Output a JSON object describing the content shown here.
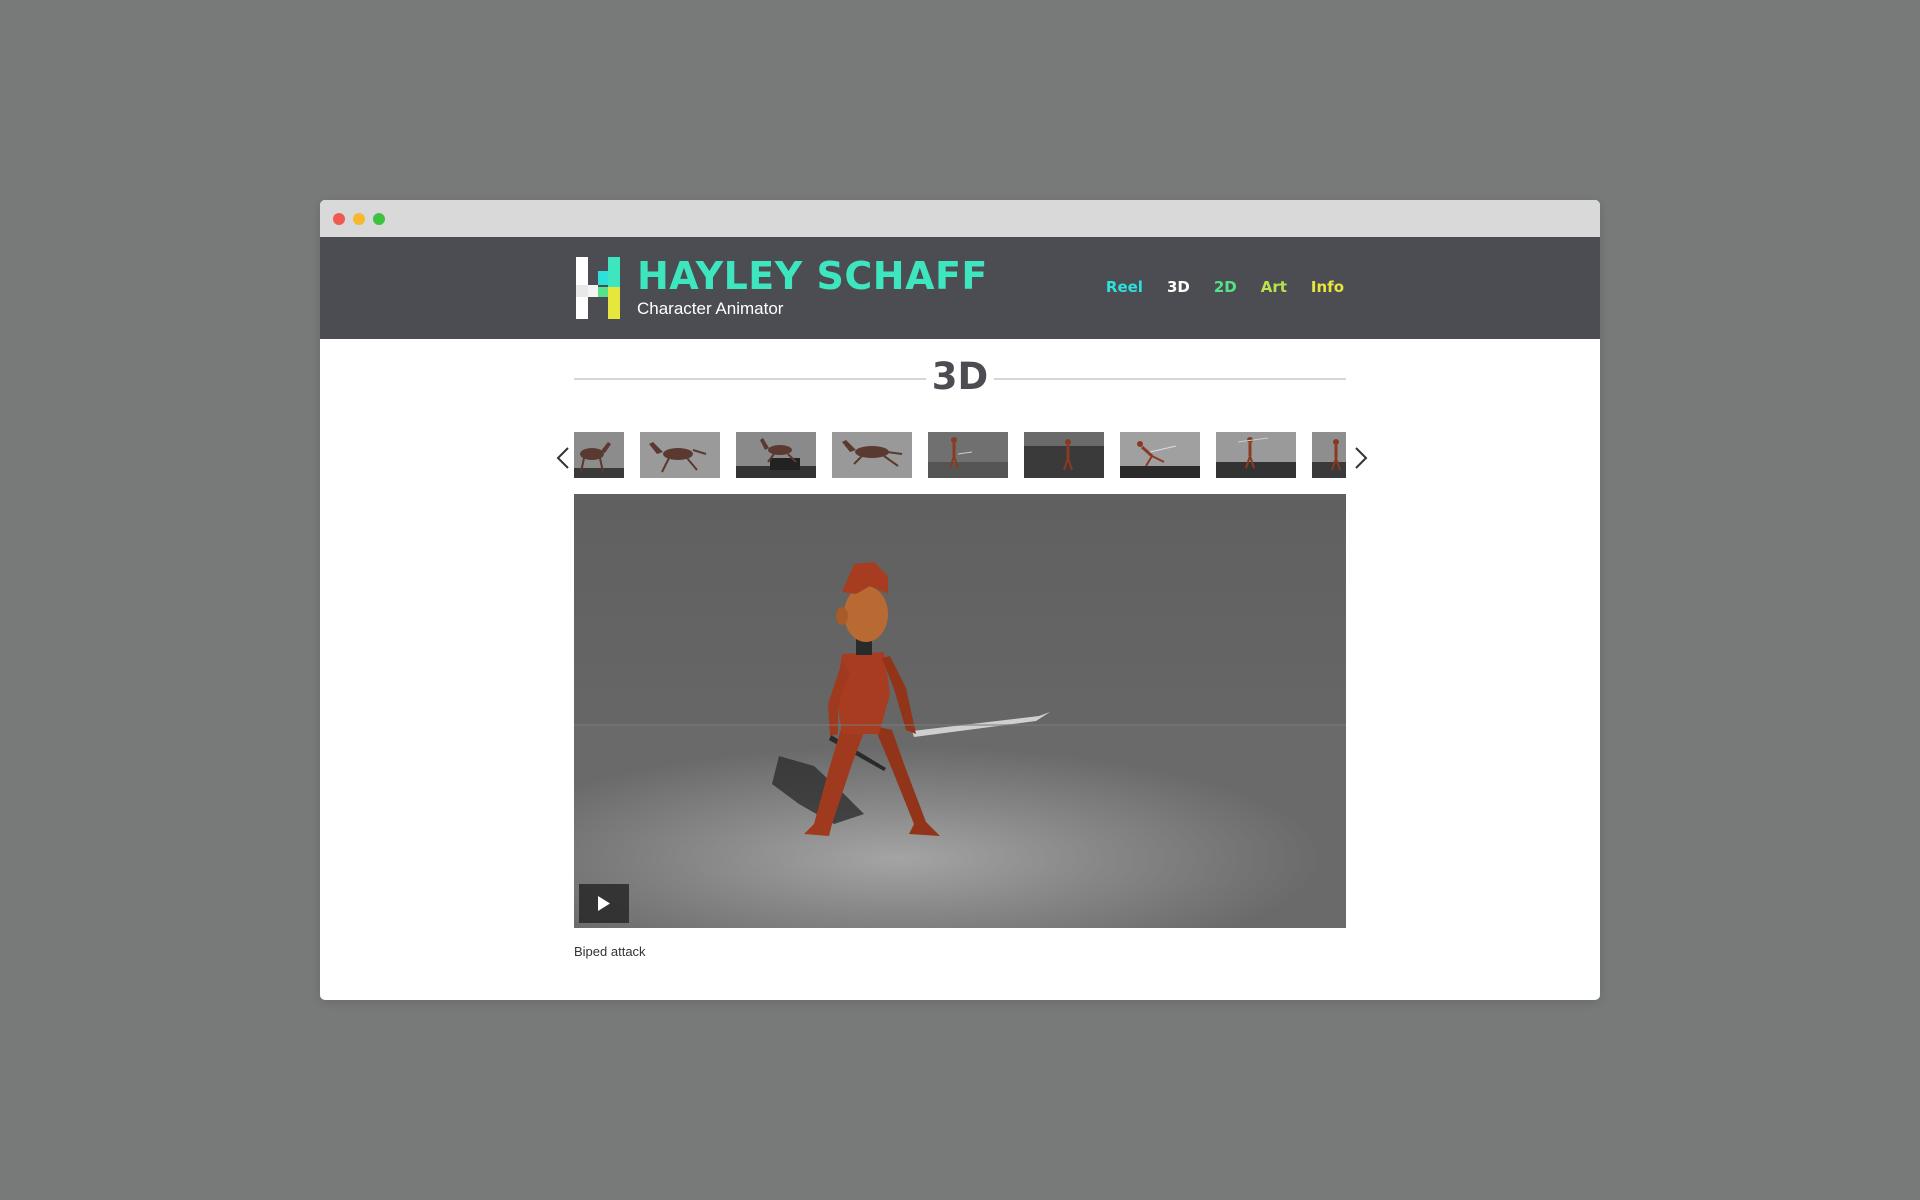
{
  "browser": {
    "controls": [
      "close",
      "minimize",
      "zoom"
    ]
  },
  "site": {
    "name": "HAYLEY SCHAFF",
    "tagline": "Character Animator",
    "logo_icon": "h-pixel-logo-icon",
    "brand_color": "#3ee6c0"
  },
  "nav": {
    "items": [
      {
        "label": "Reel",
        "color": "#2ee0dc"
      },
      {
        "label": "3D",
        "color": "#ffffff"
      },
      {
        "label": "2D",
        "color": "#54e38a"
      },
      {
        "label": "Art",
        "color": "#b8e34c"
      },
      {
        "label": "Info",
        "color": "#e6e63c"
      }
    ]
  },
  "page": {
    "title": "3D"
  },
  "carousel": {
    "prev_icon": "chevron-left-icon",
    "next_icon": "chevron-right-icon",
    "thumbnails": [
      {
        "subject": "horse"
      },
      {
        "subject": "horse"
      },
      {
        "subject": "horse"
      },
      {
        "subject": "horse"
      },
      {
        "subject": "biped"
      },
      {
        "subject": "biped"
      },
      {
        "subject": "biped"
      },
      {
        "subject": "biped"
      },
      {
        "subject": "biped"
      }
    ]
  },
  "player": {
    "play_icon": "play-icon",
    "caption": "Biped attack"
  }
}
